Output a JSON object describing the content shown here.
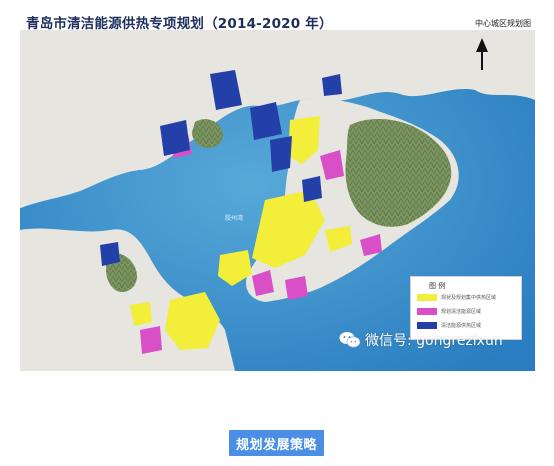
{
  "map": {
    "title": "青岛市清洁能源供热专项规划（2014-2020 年）",
    "subtitle": "中心城区规划图",
    "place_label": "胶州湾",
    "legend": {
      "title": "图 例",
      "items": [
        {
          "label": "现状及规划集中供热区域",
          "color": "#f2ee3a"
        },
        {
          "label": "规划清洁能源区域",
          "color": "#d84fc7"
        },
        {
          "label": "清洁能源供热区域",
          "color": "#233fa8"
        }
      ]
    },
    "watermark": "微信号: gongrezixun",
    "watermark_icon": "wechat-icon",
    "colors": {
      "sea": "#2c86c8",
      "sea_light": "#6fb7de",
      "land": "#e7e5df",
      "hills": "#78905a",
      "yellow": "#f2ee3a",
      "magenta": "#d84fc7",
      "blue": "#233fa8"
    }
  },
  "section_button": {
    "label": "规划发展策略"
  }
}
